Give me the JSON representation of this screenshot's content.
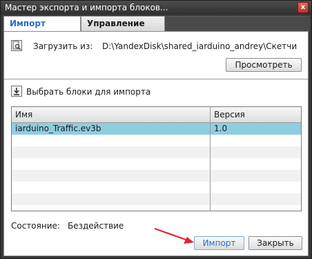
{
  "window": {
    "title": "Мастер экспорта и импорта блоков...",
    "close_glyph": "x"
  },
  "tabs": [
    {
      "label": "Импорт",
      "active": true
    },
    {
      "label": "Управление",
      "active": false
    }
  ],
  "load": {
    "label": "Загрузить из:",
    "path": "D:\\YandexDisk\\shared_iarduino_andrey\\Скетчи",
    "browse_label": "Просмотреть",
    "icon": "document-search-icon"
  },
  "select": {
    "label": "Выбрать блоки для импорта",
    "icon": "download-arrow-icon"
  },
  "table": {
    "columns": [
      "Имя",
      "Версия"
    ],
    "rows": [
      {
        "name": "iarduino_Traffic.ev3b",
        "version": "1.0",
        "selected": true
      }
    ]
  },
  "status": {
    "label": "Состояние:",
    "value": "Бездействие"
  },
  "footer": {
    "import_label": "Импорт",
    "close_label": "Закрыть"
  },
  "colors": {
    "accent_tab_text": "#2b6fbf",
    "selected_row": "#8fcde0",
    "arrow": "#e0252a"
  }
}
